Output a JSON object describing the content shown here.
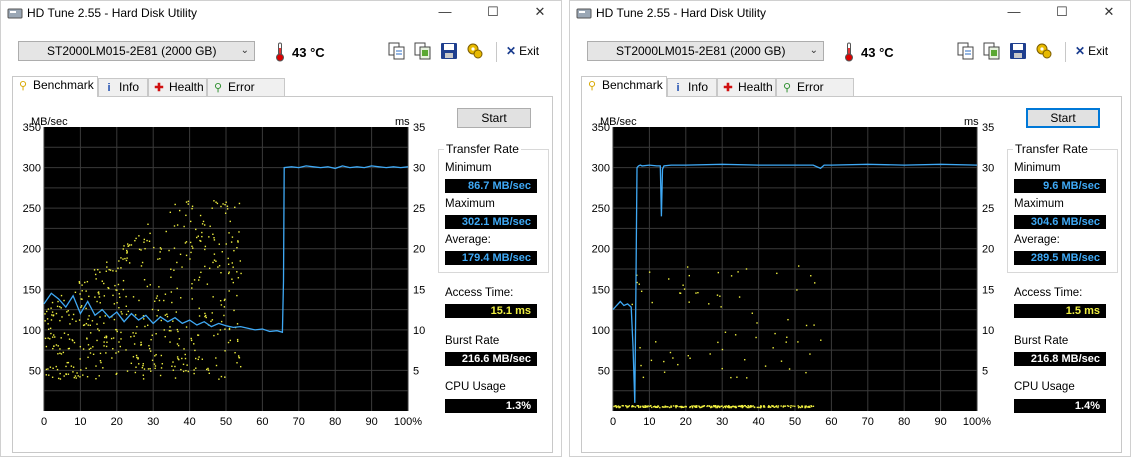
{
  "app_title": "HD Tune 2.55 - Hard Disk Utility",
  "caption": {
    "minimize": "—",
    "maximize": "☐",
    "close": "✕"
  },
  "drive": "ST2000LM015-2E81 (2000 GB)",
  "temperature": "43 °C",
  "exit_label": "Exit",
  "tabs": [
    {
      "label": "Benchmark",
      "icon": "benchmark-icon"
    },
    {
      "label": "Info",
      "icon": "info-icon"
    },
    {
      "label": "Health",
      "icon": "health-icon"
    },
    {
      "label": "Error Scan",
      "icon": "error-scan-icon"
    }
  ],
  "start_label": "Start",
  "labels": {
    "transfer_rate": "Transfer Rate",
    "minimum": "Minimum",
    "maximum": "Maximum",
    "average": "Average:",
    "access_time": "Access Time:",
    "burst_rate": "Burst Rate",
    "cpu_usage": "CPU Usage"
  },
  "colors": {
    "chart_bg": "#000000",
    "grid": "#3a3a3a",
    "transfer": "#3fa9f5",
    "access": "#f0f040",
    "value_blue": "#3fa9f5",
    "value_yellow": "#f0f040",
    "value_white": "#ffffff"
  },
  "panels": [
    {
      "minimum": "86.7 MB/sec",
      "maximum": "302.1 MB/sec",
      "average": "179.4 MB/sec",
      "access_time": "15.1 ms",
      "burst_rate": "216.6 MB/sec",
      "cpu_usage": "1.3%",
      "start_focused": false,
      "chart_data": {
        "type": "line",
        "left_axis_unit": "MB/sec",
        "right_axis_unit": "ms",
        "y_left_ticks": [
          50,
          100,
          150,
          200,
          250,
          300,
          350
        ],
        "y_right_ticks": [
          5,
          10,
          15,
          20,
          25,
          30,
          35
        ],
        "x_ticks": [
          "0",
          "10",
          "20",
          "30",
          "40",
          "50",
          "60",
          "70",
          "80",
          "90",
          "100%"
        ],
        "xlim": [
          0,
          100
        ],
        "ylim": [
          0,
          350
        ],
        "series": [
          {
            "x": [
              0,
              2,
              4,
              6,
              8,
              10,
              12,
              14,
              16,
              18,
              20,
              22,
              24,
              26,
              28,
              30,
              32,
              34,
              36,
              38,
              40,
              42,
              44,
              46,
              48,
              50,
              52,
              54,
              56,
              58,
              60,
              62,
              64,
              65.5,
              65.8,
              66,
              68,
              70,
              72,
              74,
              76,
              78,
              80,
              82,
              84,
              86,
              88,
              90,
              92,
              94,
              96,
              98,
              100
            ],
            "y": [
              132,
              145,
              138,
              128,
              142,
              120,
              135,
              118,
              125,
              115,
              122,
              110,
              120,
              112,
              118,
              108,
              116,
              110,
              115,
              108,
              112,
              106,
              110,
              104,
              108,
              105,
              103,
              104,
              102,
              100,
              101,
              98,
              99,
              97,
              160,
              300,
              301,
              300,
              302,
              301,
              300,
              301,
              299,
              302,
              300,
              301,
              300,
              302,
              301,
              300,
              301,
              300,
              301
            ]
          }
        ],
        "access_time_ms": {
          "min_ms": 4,
          "max_ms": 26,
          "spread": "wide"
        }
      }
    },
    {
      "minimum": "9.6 MB/sec",
      "maximum": "304.6 MB/sec",
      "average": "289.5 MB/sec",
      "access_time": "1.5 ms",
      "burst_rate": "216.8 MB/sec",
      "cpu_usage": "1.4%",
      "start_focused": true,
      "chart_data": {
        "type": "line",
        "left_axis_unit": "MB/sec",
        "right_axis_unit": "ms",
        "y_left_ticks": [
          50,
          100,
          150,
          200,
          250,
          300,
          350
        ],
        "y_right_ticks": [
          5,
          10,
          15,
          20,
          25,
          30,
          35
        ],
        "x_ticks": [
          "0",
          "10",
          "20",
          "30",
          "40",
          "50",
          "60",
          "70",
          "80",
          "90",
          "100%"
        ],
        "xlim": [
          0,
          100
        ],
        "ylim": [
          0,
          350
        ],
        "series": [
          {
            "x": [
              0,
              1,
              2,
              3,
              4,
              5,
              5.5,
              6,
              6.3,
              6.6,
              7,
              7.5,
              8,
              10,
              12,
              13,
              13.3,
              13.6,
              14,
              16,
              20,
              30,
              40,
              50,
              55,
              57,
              58,
              60,
              70,
              80,
              90,
              100
            ],
            "y": [
              125,
              130,
              135,
              130,
              132,
              128,
              80,
              10,
              150,
              300,
              302,
              303,
              302,
              303,
              302,
              302,
              240,
              298,
              302,
              303,
              303,
              304,
              303,
              303,
              303,
              299,
              303,
              303,
              304,
              303,
              304,
              303
            ]
          }
        ],
        "access_time_ms": {
          "min_ms": 0.5,
          "max_ms": 18,
          "spread": "baseline"
        }
      }
    }
  ]
}
